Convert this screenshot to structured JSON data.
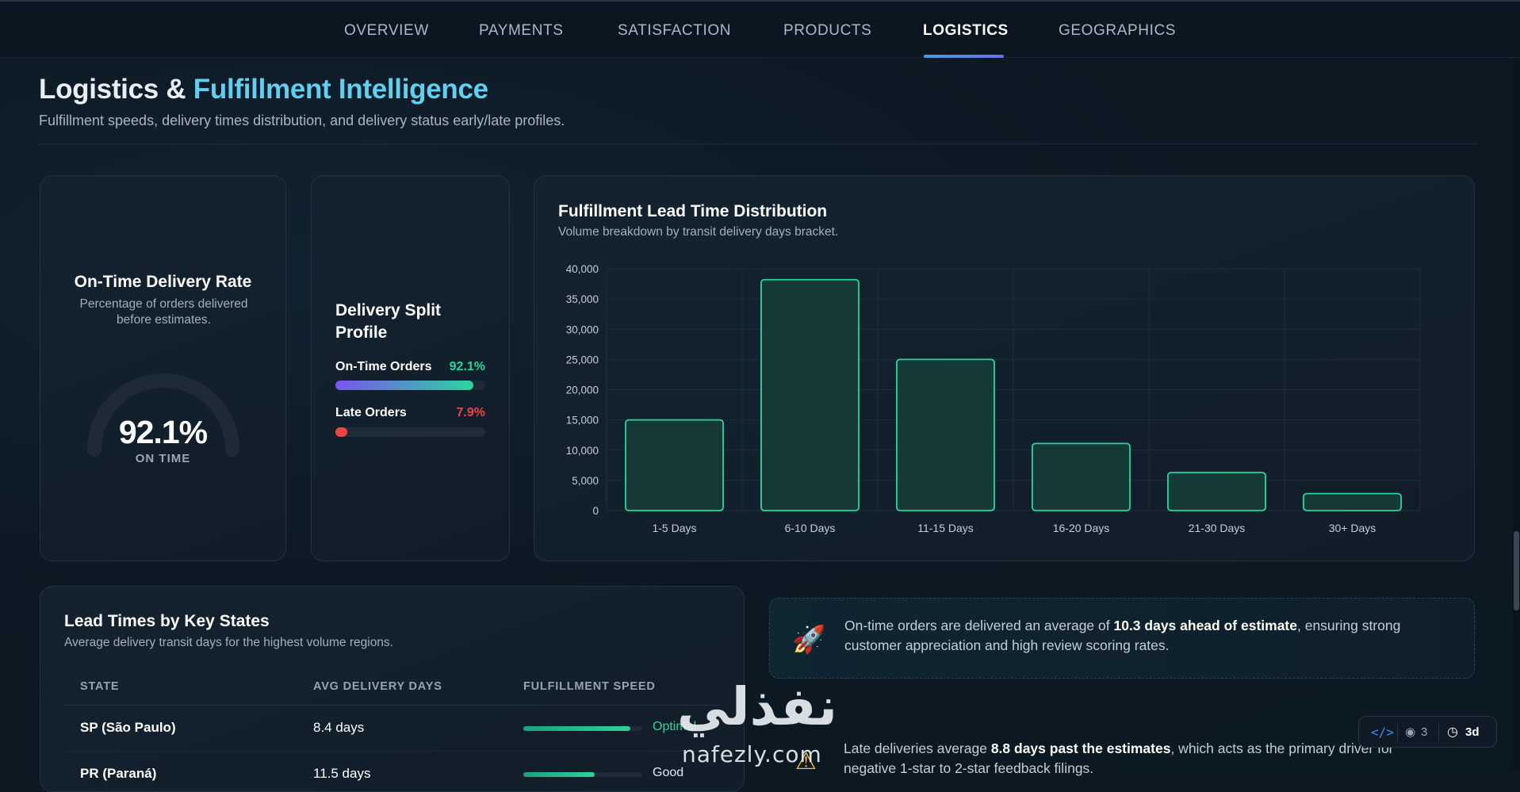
{
  "nav": {
    "tabs": [
      {
        "label": "OVERVIEW"
      },
      {
        "label": "PAYMENTS"
      },
      {
        "label": "SATISFACTION"
      },
      {
        "label": "PRODUCTS"
      },
      {
        "label": "LOGISTICS",
        "active": true
      },
      {
        "label": "GEOGRAPHICS"
      }
    ]
  },
  "header": {
    "title_part1": "Logistics &",
    "title_part2": "Fulfillment Intelligence",
    "subtitle": "Fulfillment speeds, delivery times distribution, and delivery status early/late profiles."
  },
  "ontime": {
    "title": "On-Time Delivery Rate",
    "subtitle": "Percentage of orders delivered before estimates.",
    "value": "92.1%",
    "label": "ON TIME",
    "gauge_fraction": 0
  },
  "split": {
    "title": "Delivery Split Profile",
    "ontime_label": "On-Time Orders",
    "ontime_value": "92.1%",
    "ontime_fraction": 0.921,
    "late_label": "Late Orders",
    "late_value": "7.9%",
    "late_fraction": 0.079
  },
  "chart_data": {
    "type": "bar",
    "title": "Fulfillment Lead Time Distribution",
    "subtitle": "Volume breakdown by transit delivery days bracket.",
    "categories": [
      "1-5 Days",
      "6-10 Days",
      "11-15 Days",
      "16-20 Days",
      "21-30 Days",
      "30+ Days"
    ],
    "values": [
      15000,
      38200,
      25000,
      11100,
      6300,
      2800
    ],
    "ylim": [
      0,
      40000
    ],
    "yticks": [
      0,
      5000,
      10000,
      15000,
      20000,
      25000,
      30000,
      35000,
      40000
    ],
    "ytick_labels": [
      "0",
      "5,000",
      "10,000",
      "15,000",
      "20,000",
      "25,000",
      "30,000",
      "35,000",
      "40,000"
    ],
    "xlabel": "",
    "ylabel": "",
    "grid": true,
    "colors": {
      "bar_fill": "#163a37",
      "bar_stroke": "#2ad59d",
      "grid": "#1f2d3a",
      "tick_text": "#c5ced6"
    }
  },
  "states_table": {
    "title": "Lead Times by Key States",
    "subtitle": "Average delivery transit days for the highest volume regions.",
    "columns": [
      "STATE",
      "AVG DELIVERY DAYS",
      "FULFILLMENT SPEED"
    ],
    "rows": [
      {
        "state": "SP (São Paulo)",
        "avg_days": "8.4 days",
        "speed_fraction": 0.9,
        "speed_label": "Optimal",
        "speed_color": "#2ad59d"
      },
      {
        "state": "PR (Paraná)",
        "avg_days": "11.5 days",
        "speed_fraction": 0.6,
        "speed_label": "Good",
        "speed_color": "#e2e8ee"
      }
    ]
  },
  "insights": {
    "ontime_pre": "On-time orders are delivered an average of ",
    "ontime_bold": "10.3 days ahead of estimate",
    "ontime_post": ", ensuring strong customer appreciation and high review scoring rates.",
    "late_pre": "Late deliveries average ",
    "late_bold": "8.8 days past the estimates",
    "late_post": ", which acts as the primary driver for negative 1-star to 2-star feedback filings."
  },
  "watermark": {
    "arabic": "نفذلي",
    "latin": "nafezly.com"
  },
  "status_pill": {
    "views": "3",
    "age": "3d"
  },
  "colors": {
    "accent": "#5fd0f0",
    "ontime": "#2ad59d",
    "late": "#ef4444",
    "purple": "#7b55f0"
  }
}
